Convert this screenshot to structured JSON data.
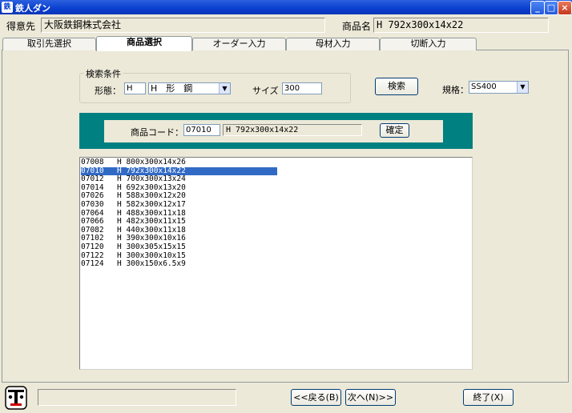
{
  "window": {
    "title": "鉄人ダン",
    "icon_glyph": "鉄"
  },
  "header": {
    "customer_label": "得意先",
    "customer_value": "大阪鉄鋼株式会社",
    "product_label": "商品名",
    "product_value": "H 792x300x14x22"
  },
  "tabs": [
    {
      "label": "取引先選択"
    },
    {
      "label": "商品選択"
    },
    {
      "label": "オーダー入力"
    },
    {
      "label": "母材入力"
    },
    {
      "label": "切断入力"
    }
  ],
  "search": {
    "group_title": "検索条件",
    "shape_label": "形態：",
    "shape_code": "H",
    "shape_name": "H　形　鋼",
    "size_label": "サイズ",
    "size_value": "300",
    "search_button": "検索",
    "spec_label": "規格：",
    "spec_value": "SS400"
  },
  "code_bar": {
    "label": "商品コード：",
    "code_value": "07010",
    "name_value": "H 792x300x14x22",
    "confirm_button": "確定"
  },
  "list": {
    "selected_index": 1,
    "rows": [
      {
        "code": "07008",
        "name": "H  800x300x14x26"
      },
      {
        "code": "07010",
        "name": "H  792x300x14x22"
      },
      {
        "code": "07012",
        "name": "H  700x300x13x24"
      },
      {
        "code": "07014",
        "name": "H  692x300x13x20"
      },
      {
        "code": "07026",
        "name": "H  588x300x12x20"
      },
      {
        "code": "07030",
        "name": "H  582x300x12x17"
      },
      {
        "code": "07064",
        "name": "H  488x300x11x18"
      },
      {
        "code": "07066",
        "name": "H  482x300x11x15"
      },
      {
        "code": "07082",
        "name": "H  440x300x11x18"
      },
      {
        "code": "07102",
        "name": "H  390x300x10x16"
      },
      {
        "code": "07120",
        "name": "H  300x305x15x15"
      },
      {
        "code": "07122",
        "name": "H  300x300x10x15"
      },
      {
        "code": "07124",
        "name": "H  300x150x6.5x9"
      }
    ]
  },
  "footer": {
    "back_button": "<<戻る(B)",
    "next_button": "次へ(N)>>",
    "exit_button": "終了(X)"
  }
}
